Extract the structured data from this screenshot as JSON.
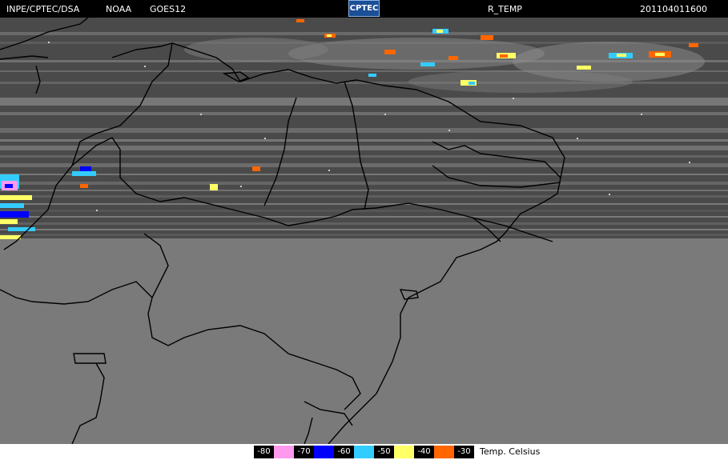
{
  "header": {
    "org": "INPE/CPTEC/DSA",
    "agency": "NOAA",
    "satellite": "GOES12",
    "logo_text": "CPTEC",
    "product": "R_TEMP",
    "datetime": "201104011600"
  },
  "legend": {
    "items": [
      {
        "label": "-80",
        "color": "#000000",
        "text_color": "#ffffff"
      },
      {
        "label": "",
        "color": "#ff99ee",
        "text_color": "#000000"
      },
      {
        "label": "-70",
        "color": "#000000",
        "text_color": "#ffffff"
      },
      {
        "label": "",
        "color": "#0000ff",
        "text_color": "#000000"
      },
      {
        "label": "-60",
        "color": "#000000",
        "text_color": "#ffffff"
      },
      {
        "label": "",
        "color": "#33ccff",
        "text_color": "#000000"
      },
      {
        "label": "-50",
        "color": "#000000",
        "text_color": "#ffffff"
      },
      {
        "label": "",
        "color": "#ffff66",
        "text_color": "#000000"
      },
      {
        "label": "-40",
        "color": "#000000",
        "text_color": "#ffffff"
      },
      {
        "label": "",
        "color": "#ff6600",
        "text_color": "#000000"
      },
      {
        "label": "-30",
        "color": "#000000",
        "text_color": "#ffffff"
      }
    ],
    "unit_label": "Temp. Celsius"
  },
  "colors": {
    "background_gray": "#7a7a7a",
    "header_bg": "#000000",
    "border_lines": "#000000"
  }
}
